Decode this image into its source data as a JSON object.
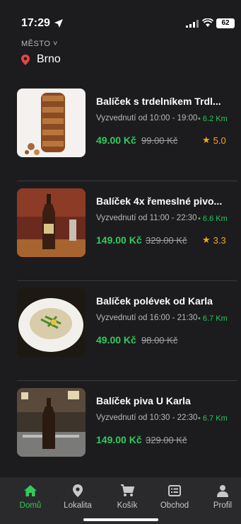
{
  "status": {
    "time": "17:29",
    "battery": "62"
  },
  "city": {
    "label": "MĚSTO ˅",
    "name": "Brno"
  },
  "items": [
    {
      "title": "Balíček s trdelníkem Trdl...",
      "pickup": "Vyzvednutí od 10:00 - 19:00",
      "distance": "6.2 Km",
      "price": "49.00 Kč",
      "old_price": "99.00 Kč",
      "rating": "5.0"
    },
    {
      "title": "Balíček 4x řemeslné pivo...",
      "pickup": "Vyzvednutí od 11:00 - 22:30",
      "distance": "6.6 Km",
      "price": "149.00 Kč",
      "old_price": "329.00 Kč",
      "rating": "3.3"
    },
    {
      "title": "Balíček polévek od Karla",
      "pickup": "Vyzvednutí od 16:00 - 21:30",
      "distance": "6.7 Km",
      "price": "49.00 Kč",
      "old_price": "98.00 Kč",
      "rating": ""
    },
    {
      "title": "Balíček piva U Karla",
      "pickup": "Vyzvednutí od 10:30 - 22:30",
      "distance": "6.7 Km",
      "price": "149.00 Kč",
      "old_price": "329.00 Kč",
      "rating": ""
    }
  ],
  "tabs": [
    {
      "label": "Domů",
      "icon": "home-icon",
      "active": true
    },
    {
      "label": "Lokalita",
      "icon": "location-pin-icon"
    },
    {
      "label": "Košík",
      "icon": "cart-icon"
    },
    {
      "label": "Obchod",
      "icon": "store-list-icon"
    },
    {
      "label": "Profil",
      "icon": "user-icon"
    }
  ],
  "colors": {
    "accent": "#2ecc5d",
    "star": "#f5a623",
    "background": "#1c1c1e"
  }
}
